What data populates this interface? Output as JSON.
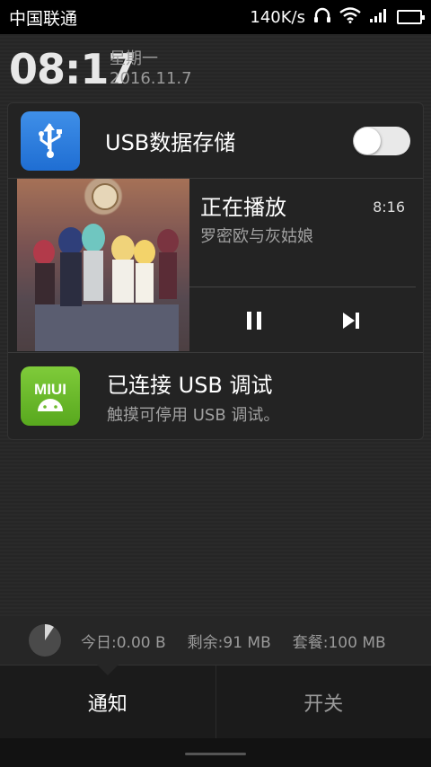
{
  "status_bar": {
    "carrier": "中国联通",
    "speed": "140K/s",
    "icons": [
      "headset-icon",
      "wifi-icon",
      "signal-icon",
      "battery-icon"
    ],
    "battery_color": "#6bd23a"
  },
  "header": {
    "time": "08:17",
    "weekday": "星期一",
    "date": "2016.11.7"
  },
  "notifications": {
    "usb_storage": {
      "title": "USB数据存储",
      "icon": "usb-icon",
      "toggle_on": false
    },
    "music": {
      "title": "正在播放",
      "time": "8:16",
      "artist": "罗密欧与灰姑娘",
      "controls": [
        "pause-icon",
        "next-icon"
      ]
    },
    "usb_debug": {
      "icon_label": "MIUI",
      "title": "已连接 USB 调试",
      "subtitle": "触摸可停用 USB 调试。"
    }
  },
  "data_usage": {
    "today": "今日:0.00 B",
    "remaining": "剩余:91 MB",
    "plan": "套餐:100 MB"
  },
  "tabs": [
    {
      "label": "通知",
      "active": true
    },
    {
      "label": "开关",
      "active": false
    }
  ]
}
